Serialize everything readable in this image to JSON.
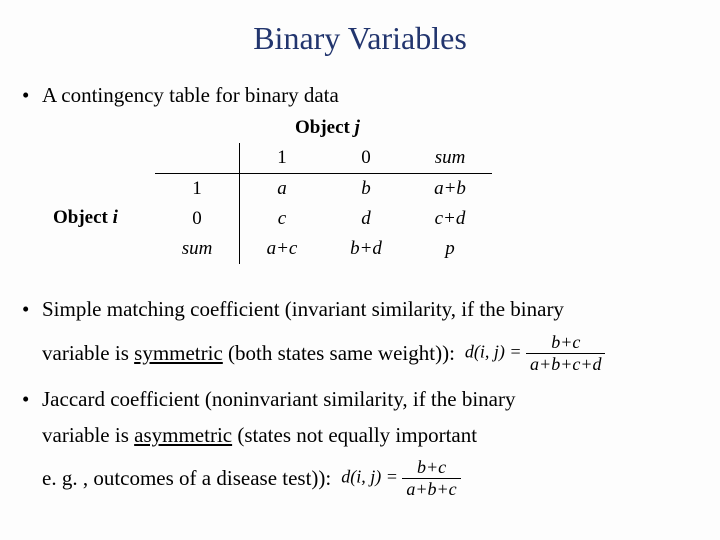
{
  "title": "Binary Variables",
  "bullets": {
    "contingency": "A contingency table for binary data",
    "simple_matching": "Simple matching coefficient (invariant similarity, if the binary",
    "simple_matching_line2_pre": "variable is ",
    "simple_matching_sym": "symmetric",
    "simple_matching_line2_post": " (both states same weight)):",
    "jaccard": "Jaccard coefficient (noninvariant similarity, if the binary",
    "jaccard_line2_pre": "variable is ",
    "jaccard_asym": "asymmetric",
    "jaccard_line2_post": " (states not equally important",
    "jaccard_line3": "e. g. , outcomes of a disease test)):"
  },
  "labels": {
    "object_j_pre": "Object",
    "object_j_var": " j",
    "object_i_pre": "Object",
    "object_i_var": " i"
  },
  "table": {
    "h1": "1",
    "h0": "0",
    "hsum": "sum",
    "r1": "1",
    "r0": "0",
    "rsum": "sum",
    "a": "a",
    "b": "b",
    "ab": "a+b",
    "c": "c",
    "d": "d",
    "cd": "c+d",
    "ac": "a+c",
    "bd": "b+d",
    "p": "p"
  },
  "formulas": {
    "dij": "d(i, j) = ",
    "sm_num": "b+c",
    "sm_den": "a+b+c+d",
    "jc_num": "b+c",
    "jc_den": "a+b+c"
  }
}
